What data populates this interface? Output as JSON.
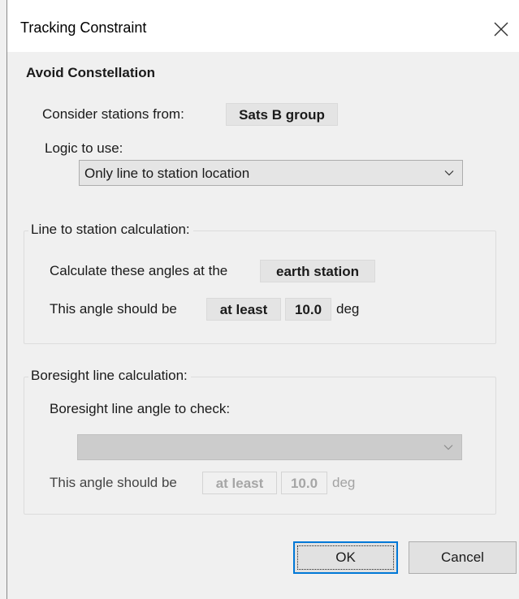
{
  "window": {
    "title": "Tracking Constraint",
    "close_icon": "close-icon"
  },
  "avoid": {
    "section_title": "Avoid Constellation",
    "consider_label": "Consider stations from:",
    "consider_value": "Sats B group",
    "logic_label": "Logic to use:",
    "logic_value": "Only line to station location"
  },
  "line_calc": {
    "legend": "Line to station calculation:",
    "angles_label": "Calculate these angles at the",
    "angles_value": "earth station",
    "angle_prefix": "This angle should be",
    "comparison": "at least",
    "angle_value": "10.0",
    "unit": "deg"
  },
  "boresight": {
    "legend": "Boresight line calculation:",
    "check_label": "Boresight line angle to check:",
    "dropdown_value": "",
    "angle_prefix": "This angle should be",
    "comparison": "at least",
    "angle_value": "10.0",
    "unit": "deg"
  },
  "buttons": {
    "ok": "OK",
    "cancel": "Cancel"
  },
  "colors": {
    "accent": "#0078d7",
    "disabled_text": "#a3a3a3"
  }
}
